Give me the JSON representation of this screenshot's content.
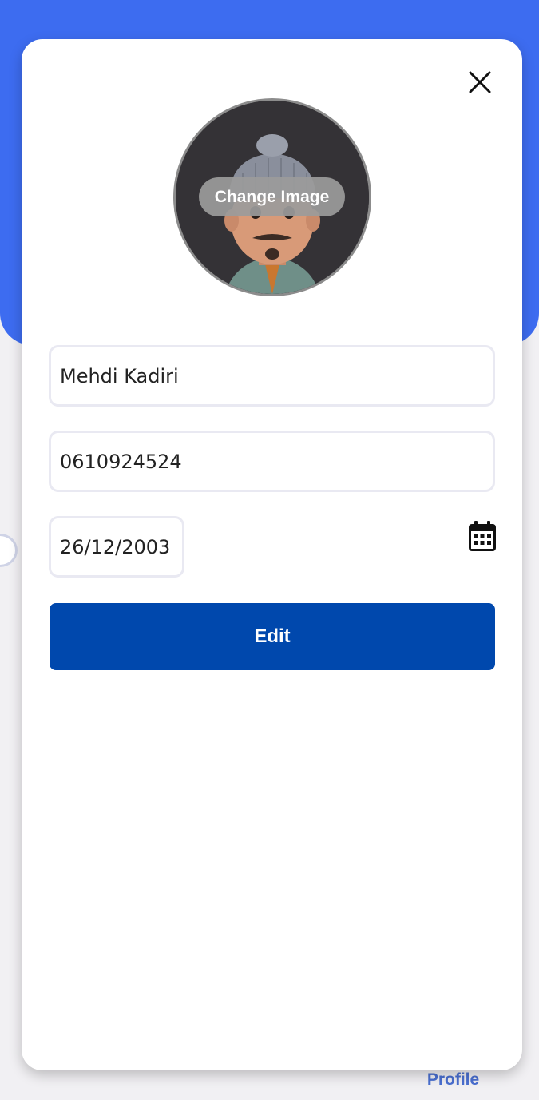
{
  "profile_form": {
    "change_image_label": "Change Image",
    "name_value": "Mehdi Kadiri",
    "phone_value": "0610924524",
    "birthdate_value": "26/12/2003",
    "edit_label": "Edit"
  },
  "icons": {
    "close": "close-icon",
    "calendar": "calendar-icon",
    "avatar": "avatar-image"
  },
  "bottom_nav": {
    "profile_label": "Profile"
  },
  "colors": {
    "header_blue": "#3d6cf0",
    "edit_button": "#0048ad",
    "nav_profile_text": "#4a6fd0"
  }
}
